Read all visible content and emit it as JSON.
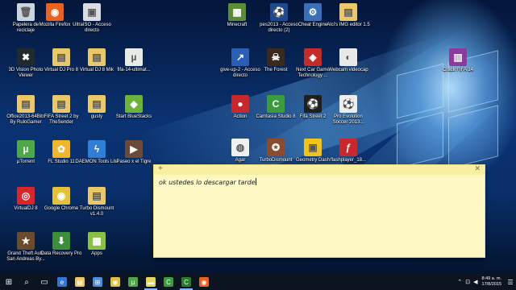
{
  "desktop_icons": [
    {
      "label": "Papelera de reciclaje",
      "icon": "recycle-bin-icon",
      "color": "#c9d4de",
      "glyph": "🗑"
    },
    {
      "label": "Mozilla Firefox",
      "icon": "firefox-icon",
      "color": "#e8631f",
      "glyph": "◉"
    },
    {
      "label": "UltraISO - Acceso directo",
      "icon": "ultraiso-icon",
      "color": "#d9dde3",
      "glyph": "▣"
    },
    {
      "label": "3D Vision Photo Viewer",
      "icon": "3d-vision-icon",
      "color": "#1e2a2e",
      "glyph": "✖"
    },
    {
      "label": "Virtual DJ Pro 8",
      "icon": "folder-icon",
      "color": "#e9c86a",
      "glyph": "▤"
    },
    {
      "label": "Virtual DJ 8 Mik",
      "icon": "folder-icon",
      "color": "#e9c86a",
      "glyph": "▤"
    },
    {
      "label": "fifa-14-ultimat...",
      "icon": "utorrent-file-icon",
      "color": "#e6ebe6",
      "glyph": "µ"
    },
    {
      "label": "Office2013-64Bits By RuloGamer",
      "icon": "office-folder-icon",
      "color": "#e9c86a",
      "glyph": "▤"
    },
    {
      "label": "FIFA Street 2 by TheSender",
      "icon": "folder-icon",
      "color": "#e9c86a",
      "glyph": "▤"
    },
    {
      "label": "gusty",
      "icon": "folder-icon",
      "color": "#e9c86a",
      "glyph": "▤"
    },
    {
      "label": "Start BlueStacks",
      "icon": "bluestacks-icon",
      "color": "#6bb33c",
      "glyph": "◆"
    },
    {
      "label": "µTorrent",
      "icon": "utorrent-icon",
      "color": "#4ea84a",
      "glyph": "µ"
    },
    {
      "label": "FL Studio 11",
      "icon": "fl-studio-icon",
      "color": "#f1b52c",
      "glyph": "✿"
    },
    {
      "label": "DAEMON Tools Lite",
      "icon": "daemon-tools-icon",
      "color": "#2f7fd6",
      "glyph": "ϟ"
    },
    {
      "label": "Paseo x el Tigre",
      "icon": "video-file-icon",
      "color": "#6a4b3a",
      "glyph": "▶"
    },
    {
      "label": "VirtualDJ 8",
      "icon": "virtualdj-icon",
      "color": "#d7262e",
      "glyph": "◎"
    },
    {
      "label": "Google Chrome",
      "icon": "chrome-icon",
      "color": "#e3c23a",
      "glyph": "◉"
    },
    {
      "label": "Turbo Dismount v1.4.0",
      "icon": "folder-icon",
      "color": "#e9c86a",
      "glyph": "▤"
    },
    {
      "label": "Grand Theft Auto San Andreas By...",
      "icon": "gta-icon",
      "color": "#6b4b2e",
      "glyph": "★"
    },
    {
      "label": "Data Recovery Pro",
      "icon": "data-recovery-icon",
      "color": "#3b8f3a",
      "glyph": "⬇"
    },
    {
      "label": "Apps",
      "icon": "android-apps-icon",
      "color": "#89c046",
      "glyph": "▦"
    },
    {
      "label": "Minecraft",
      "icon": "minecraft-icon",
      "color": "#5b8c37",
      "glyph": "▩"
    },
    {
      "label": "pes2013 - Acceso directo (2)",
      "icon": "pes2013-icon",
      "color": "#1d4a8e",
      "glyph": "⚽"
    },
    {
      "label": "Cheat Engine",
      "icon": "cheat-engine-icon",
      "color": "#3a6fb7",
      "glyph": "⚙"
    },
    {
      "label": "Alci's IMG editor 1.5",
      "icon": "folder-icon",
      "color": "#e9c86a",
      "glyph": "▤"
    },
    {
      "label": "give-up-2 - Acceso directo",
      "icon": "give-up-icon",
      "color": "#2b5fb4",
      "glyph": "↗"
    },
    {
      "label": "The Forest",
      "icon": "the-forest-icon",
      "color": "#3a2a1e",
      "glyph": "☠"
    },
    {
      "label": "Next Car Game Technology ...",
      "icon": "next-car-game-icon",
      "color": "#c42b2b",
      "glyph": "◈"
    },
    {
      "label": "Webcam videocap",
      "icon": "webcam-icon",
      "color": "#e8e8e8",
      "glyph": "◐"
    },
    {
      "label": "Crack FIFA 14",
      "icon": "winrar-icon",
      "color": "#8b3a9e",
      "glyph": "▥"
    },
    {
      "label": "Action",
      "icon": "action-icon",
      "color": "#c8282d",
      "glyph": "●"
    },
    {
      "label": "Camtasia Studio 8",
      "icon": "camtasia-icon",
      "color": "#3c9b3c",
      "glyph": "C"
    },
    {
      "label": "Fifa Street 2",
      "icon": "fifa-street-icon",
      "color": "#1f1f1f",
      "glyph": "⚽"
    },
    {
      "label": "Pro Evolution Soccer 2013...",
      "icon": "pes-icon",
      "color": "#eeeeee",
      "glyph": "⚽"
    },
    {
      "label": "Agar",
      "icon": "agar-icon",
      "color": "#f0f0f0",
      "glyph": "◍"
    },
    {
      "label": "TurboDismount",
      "icon": "turbo-dismount-icon",
      "color": "#8a4b2e",
      "glyph": "✪"
    },
    {
      "label": "Geometry Dash",
      "icon": "geometry-dash-icon",
      "color": "#f0c419",
      "glyph": "▣"
    },
    {
      "label": "flashplayer_18...",
      "icon": "flash-player-icon",
      "color": "#c8282d",
      "glyph": "ƒ"
    }
  ],
  "sticky_note": {
    "add_label": "+",
    "close_label": "✕",
    "text": "ok ustedes lo descargar tarde"
  },
  "taskbar": {
    "items": [
      {
        "name": "start-button",
        "glyph": "⊞",
        "active": false,
        "color": ""
      },
      {
        "name": "search-icon",
        "glyph": "⌕",
        "active": false,
        "color": ""
      },
      {
        "name": "task-view-icon",
        "glyph": "▭",
        "active": false,
        "color": ""
      },
      {
        "name": "edge-icon",
        "glyph": "e",
        "active": false,
        "color": "#3277d8"
      },
      {
        "name": "file-explorer-icon",
        "glyph": "▤",
        "active": false,
        "color": "#e9c86a"
      },
      {
        "name": "store-icon",
        "glyph": "⊞",
        "active": false,
        "color": "#4a8fe0"
      },
      {
        "name": "chrome-icon",
        "glyph": "◉",
        "active": false,
        "color": "#e3c23a"
      },
      {
        "name": "utorrent-icon",
        "glyph": "µ",
        "active": false,
        "color": "#4ea84a"
      },
      {
        "name": "sticky-notes-icon",
        "glyph": "▬",
        "active": true,
        "color": "#e4d75a"
      },
      {
        "name": "camtasia-icon",
        "glyph": "C",
        "active": false,
        "color": "#3c9b3c"
      },
      {
        "name": "camtasia-recorder-icon",
        "glyph": "C",
        "active": true,
        "color": "#2a7d2a"
      },
      {
        "name": "firefox-icon",
        "glyph": "◉",
        "active": false,
        "color": "#e8631f"
      }
    ],
    "tray": {
      "up_arrow": "⌃",
      "network": "⊡",
      "volume": "◀",
      "time": "8:49 a. m.",
      "date": "17/8/2015",
      "notifications": "☰"
    }
  }
}
